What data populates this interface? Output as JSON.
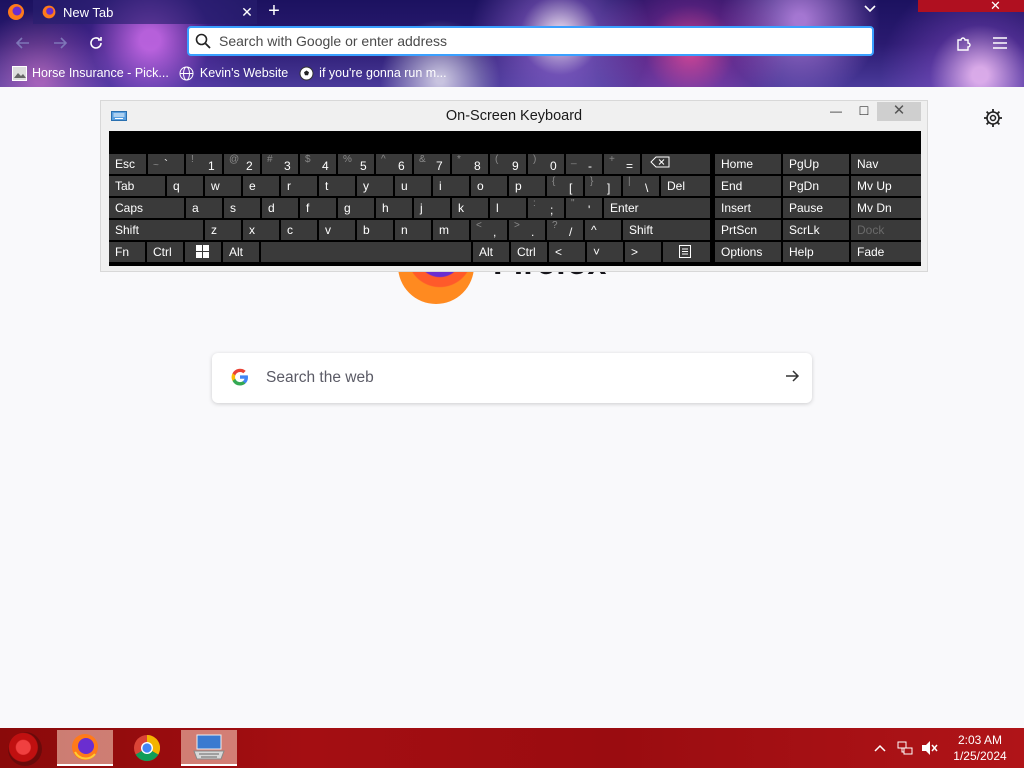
{
  "browser": {
    "tab_title": "New Tab",
    "url_placeholder": "Search with Google or enter address",
    "bookmarks": [
      {
        "label": "Horse Insurance - Pick...",
        "icon": "image-icon"
      },
      {
        "label": "Kevin's Website",
        "icon": "globe-icon"
      },
      {
        "label": "if you're gonna run m...",
        "icon": "soccer-icon"
      }
    ]
  },
  "newtab": {
    "logo_text": "Firefox",
    "search_placeholder": "Search the web",
    "google_letter": "G"
  },
  "osk": {
    "title": "On-Screen Keyboard",
    "minimize": "—",
    "maximize": "☐",
    "close": "✕",
    "row1": [
      {
        "main": "Esc"
      },
      {
        "shift": "~",
        "main": "`"
      },
      {
        "shift": "!",
        "main": "1"
      },
      {
        "shift": "@",
        "main": "2"
      },
      {
        "shift": "#",
        "main": "3"
      },
      {
        "shift": "$",
        "main": "4"
      },
      {
        "shift": "%",
        "main": "5"
      },
      {
        "shift": "^",
        "main": "6"
      },
      {
        "shift": "&",
        "main": "7"
      },
      {
        "shift": "*",
        "main": "8"
      },
      {
        "shift": "(",
        "main": "9"
      },
      {
        "shift": ")",
        "main": "0"
      },
      {
        "shift": "_",
        "main": "-"
      },
      {
        "shift": "+",
        "main": "="
      },
      {
        "main": "⌫"
      }
    ],
    "row2": [
      "Tab",
      "q",
      "w",
      "e",
      "r",
      "t",
      "y",
      "u",
      "i",
      "o",
      "p"
    ],
    "row2_extra": [
      {
        "shift": "{",
        "main": "["
      },
      {
        "shift": "}",
        "main": "]"
      },
      {
        "shift": "|",
        "main": "\\"
      },
      {
        "main": "Del"
      }
    ],
    "row3": [
      "Caps",
      "a",
      "s",
      "d",
      "f",
      "g",
      "h",
      "j",
      "k",
      "l"
    ],
    "row3_extra": [
      {
        "shift": ":",
        "main": ";"
      },
      {
        "shift": "\"",
        "main": "'"
      },
      {
        "main": "Enter"
      }
    ],
    "row4": [
      "Shift",
      "z",
      "x",
      "c",
      "v",
      "b",
      "n",
      "m"
    ],
    "row4_extra": [
      {
        "shift": "<",
        "main": ","
      },
      {
        "shift": ">",
        "main": "."
      },
      {
        "shift": "?",
        "main": "/"
      },
      {
        "main": "^"
      },
      {
        "main": "Shift"
      }
    ],
    "row5": {
      "fn": "Fn",
      "ctrl": "Ctrl",
      "alt": "Alt",
      "alt2": "Alt",
      "ctrl2": "Ctrl",
      "left": "<",
      "down": "˅",
      "right": ">"
    },
    "side": [
      [
        "Home",
        "PgUp",
        "Nav"
      ],
      [
        "End",
        "PgDn",
        "Mv Up"
      ],
      [
        "Insert",
        "Pause",
        "Mv Dn"
      ],
      [
        "PrtScn",
        "ScrLk",
        "Dock"
      ],
      [
        "Options",
        "Help",
        "Fade"
      ]
    ]
  },
  "taskbar": {
    "time": "2:03 AM",
    "date": "1/25/2024"
  }
}
